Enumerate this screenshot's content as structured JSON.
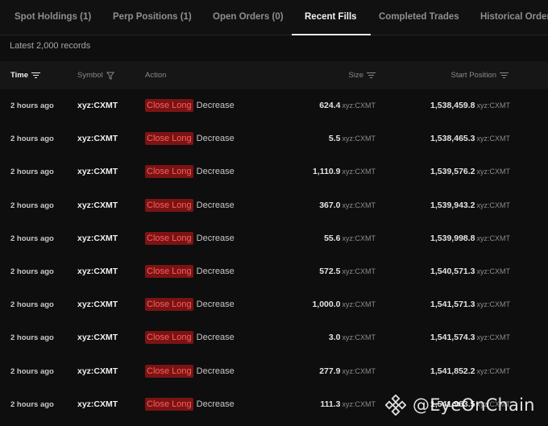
{
  "tabs": [
    {
      "label": "Spot Holdings (1)",
      "active": false
    },
    {
      "label": "Perp Positions (1)",
      "active": false
    },
    {
      "label": "Open Orders (0)",
      "active": false
    },
    {
      "label": "Recent Fills",
      "active": true
    },
    {
      "label": "Completed Trades",
      "active": false
    },
    {
      "label": "Historical Orders",
      "active": false
    }
  ],
  "records_label": "Latest 2,000 records",
  "columns": {
    "time": "Time",
    "symbol": "Symbol",
    "action": "Action",
    "size": "Size",
    "start_position": "Start Position"
  },
  "colors": {
    "badge_bg": "#7a1414",
    "badge_text": "#ff5c5c",
    "background": "#0e0e0e"
  },
  "rows": [
    {
      "time": "2 hours ago",
      "symbol": "xyz:CXMT",
      "action": "Close Long",
      "direction": "Decrease",
      "size": "624.4",
      "size_unit": "xyz:CXMT",
      "start": "1,538,459.8",
      "start_unit": "xyz:CXMT"
    },
    {
      "time": "2 hours ago",
      "symbol": "xyz:CXMT",
      "action": "Close Long",
      "direction": "Decrease",
      "size": "5.5",
      "size_unit": "xyz:CXMT",
      "start": "1,538,465.3",
      "start_unit": "xyz:CXMT"
    },
    {
      "time": "2 hours ago",
      "symbol": "xyz:CXMT",
      "action": "Close Long",
      "direction": "Decrease",
      "size": "1,110.9",
      "size_unit": "xyz:CXMT",
      "start": "1,539,576.2",
      "start_unit": "xyz:CXMT"
    },
    {
      "time": "2 hours ago",
      "symbol": "xyz:CXMT",
      "action": "Close Long",
      "direction": "Decrease",
      "size": "367.0",
      "size_unit": "xyz:CXMT",
      "start": "1,539,943.2",
      "start_unit": "xyz:CXMT"
    },
    {
      "time": "2 hours ago",
      "symbol": "xyz:CXMT",
      "action": "Close Long",
      "direction": "Decrease",
      "size": "55.6",
      "size_unit": "xyz:CXMT",
      "start": "1,539,998.8",
      "start_unit": "xyz:CXMT"
    },
    {
      "time": "2 hours ago",
      "symbol": "xyz:CXMT",
      "action": "Close Long",
      "direction": "Decrease",
      "size": "572.5",
      "size_unit": "xyz:CXMT",
      "start": "1,540,571.3",
      "start_unit": "xyz:CXMT"
    },
    {
      "time": "2 hours ago",
      "symbol": "xyz:CXMT",
      "action": "Close Long",
      "direction": "Decrease",
      "size": "1,000.0",
      "size_unit": "xyz:CXMT",
      "start": "1,541,571.3",
      "start_unit": "xyz:CXMT"
    },
    {
      "time": "2 hours ago",
      "symbol": "xyz:CXMT",
      "action": "Close Long",
      "direction": "Decrease",
      "size": "3.0",
      "size_unit": "xyz:CXMT",
      "start": "1,541,574.3",
      "start_unit": "xyz:CXMT"
    },
    {
      "time": "2 hours ago",
      "symbol": "xyz:CXMT",
      "action": "Close Long",
      "direction": "Decrease",
      "size": "277.9",
      "size_unit": "xyz:CXMT",
      "start": "1,541,852.2",
      "start_unit": "xyz:CXMT"
    },
    {
      "time": "2 hours ago",
      "symbol": "xyz:CXMT",
      "action": "Close Long",
      "direction": "Decrease",
      "size": "111.3",
      "size_unit": "xyz:CXMT",
      "start": "1,541,963.5",
      "start_unit": "xyz:CXMT"
    }
  ],
  "watermark": {
    "text": "@EyeOnChain",
    "icon": "binance-logo-icon"
  }
}
